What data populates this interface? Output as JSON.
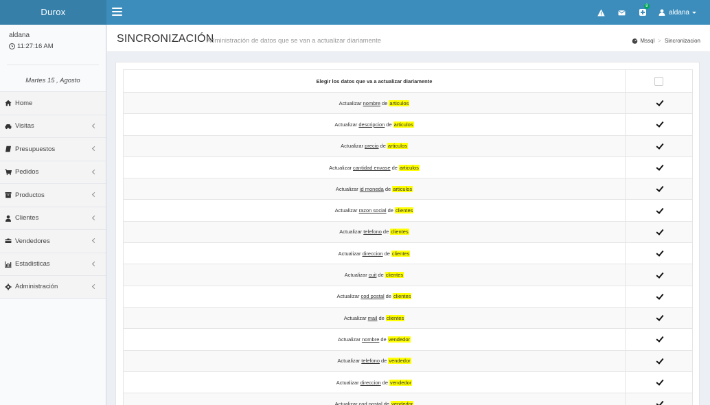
{
  "brand": "Durox",
  "user": {
    "name": "aldana",
    "menu_label": "aldana",
    "time": "11:27:16 AM",
    "date": "Martes 15 , Agosto"
  },
  "topbar": {
    "badge_count": "8"
  },
  "sidebar": {
    "items": [
      {
        "label": "Home",
        "icon": "home-icon",
        "has_chevron": false
      },
      {
        "label": "Visitas",
        "icon": "car-icon",
        "has_chevron": true
      },
      {
        "label": "Presupuestos",
        "icon": "book-icon",
        "has_chevron": true
      },
      {
        "label": "Pedidos",
        "icon": "cart-icon",
        "has_chevron": true
      },
      {
        "label": "Productos",
        "icon": "archive-icon",
        "has_chevron": true
      },
      {
        "label": "Clientes",
        "icon": "user-icon",
        "has_chevron": true
      },
      {
        "label": "Vendedores",
        "icon": "truck-icon",
        "has_chevron": true
      },
      {
        "label": "Estadisticas",
        "icon": "chart-icon",
        "has_chevron": true
      },
      {
        "label": "Administración",
        "icon": "gear-icon",
        "has_chevron": true
      }
    ]
  },
  "header": {
    "title": "SINCRONIZACIÓN",
    "subtitle": "Administración de datos que se van a actualizar diariamente",
    "breadcrumb": [
      "Mssql",
      "Sincronizacion"
    ]
  },
  "table": {
    "header": "Elegir los datos que va a actualizar diariamente",
    "rows": [
      {
        "prefix": "Actualizar",
        "field": "nombre",
        "mid": "de",
        "table": "articulos",
        "checked": true
      },
      {
        "prefix": "Actualizar",
        "field": "descripcion",
        "mid": "de",
        "table": "articulos",
        "checked": true
      },
      {
        "prefix": "Actualizar",
        "field": "precio",
        "mid": "de",
        "table": "articulos",
        "checked": true
      },
      {
        "prefix": "Actualizar",
        "field": "cantidad envase",
        "mid": "de",
        "table": "articulos",
        "checked": true
      },
      {
        "prefix": "Actualizar",
        "field": "id moneda",
        "mid": "de",
        "table": "articulos",
        "checked": true
      },
      {
        "prefix": "Actualizar",
        "field": "razon social",
        "mid": "de",
        "table": "clientes",
        "checked": true
      },
      {
        "prefix": "Actualizar",
        "field": "telefono",
        "mid": "de",
        "table": "clientes",
        "checked": true
      },
      {
        "prefix": "Actualizar",
        "field": "direccion",
        "mid": "de",
        "table": "clientes",
        "checked": true
      },
      {
        "prefix": "Actualizar",
        "field": "cuit",
        "mid": "de",
        "table": "clientes",
        "checked": true
      },
      {
        "prefix": "Actualizar",
        "field": "cod postal",
        "mid": "de",
        "table": "clientes",
        "checked": true
      },
      {
        "prefix": "Actualizar",
        "field": "mail",
        "mid": "de",
        "table": "clientes",
        "checked": true
      },
      {
        "prefix": "Actualizar",
        "field": "nombre",
        "mid": "de",
        "table": "vendedor",
        "checked": true
      },
      {
        "prefix": "Actualizar",
        "field": "telefono",
        "mid": "de",
        "table": "vendedor",
        "checked": true
      },
      {
        "prefix": "Actualizar",
        "field": "direccion",
        "mid": "de",
        "table": "vendedor",
        "checked": true
      },
      {
        "prefix": "Actualizar",
        "field": "cod postal",
        "mid": "de",
        "table": "vendedor",
        "checked": true
      }
    ]
  }
}
